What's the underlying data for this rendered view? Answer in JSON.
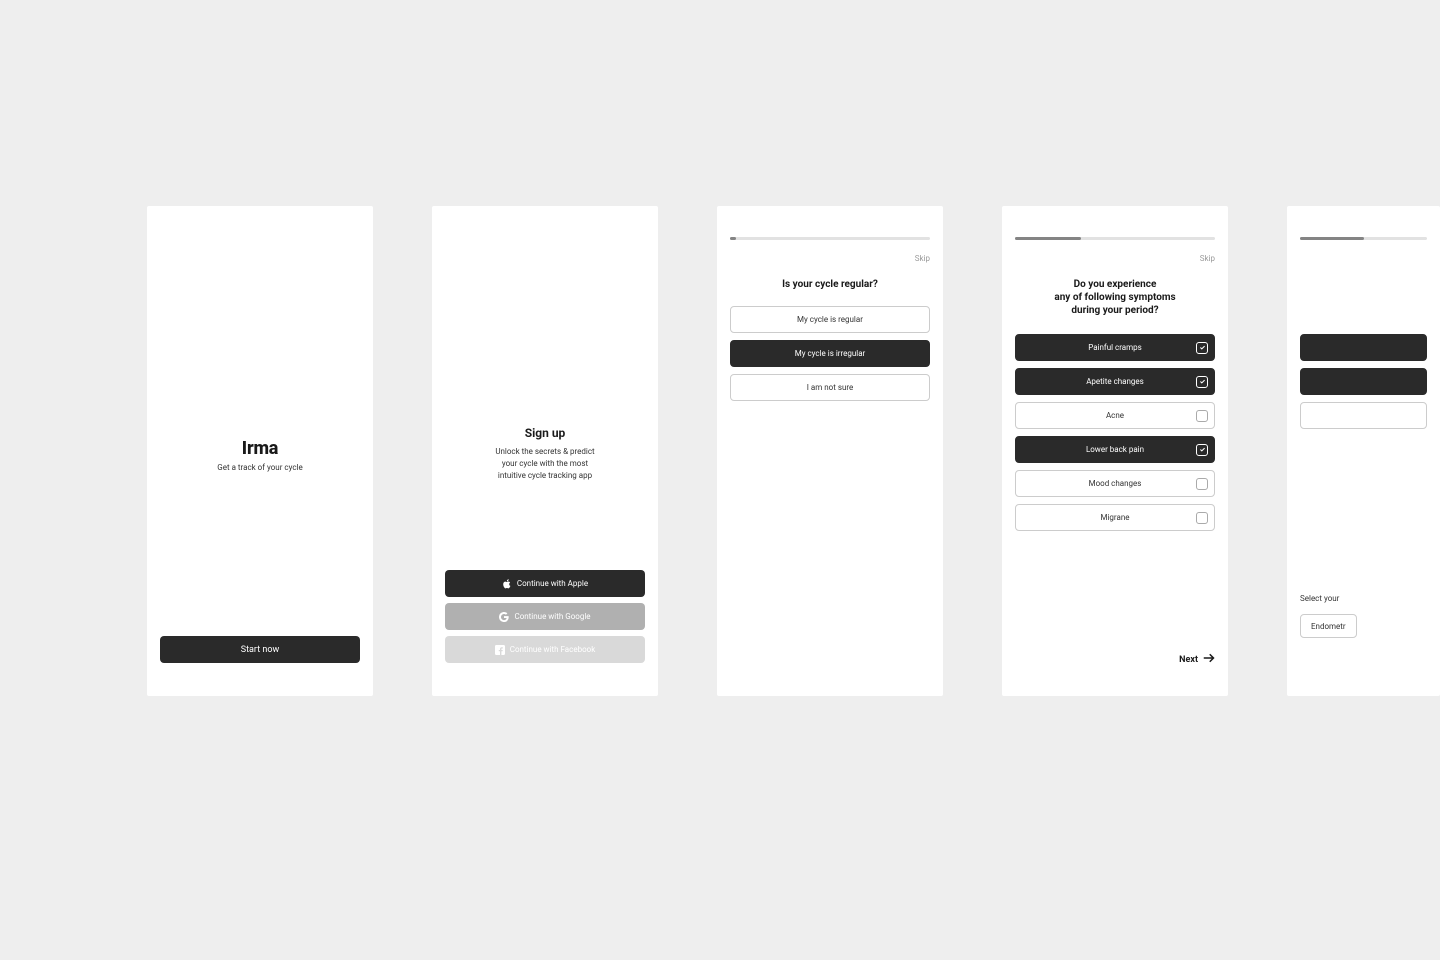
{
  "screen1": {
    "title": "Irma",
    "subtitle": "Get a track of your cycle",
    "start_button": "Start now"
  },
  "screen2": {
    "title": "Sign up",
    "description_line1": "Unlock the secrets & predict",
    "description_line2": "your cycle with the most",
    "description_line3": "intuitive cycle tracking app",
    "apple": "Continue with Apple",
    "google": "Continue with Google",
    "facebook": "Continue with Facebook"
  },
  "screen3": {
    "skip": "Skip",
    "question": "Is your cycle regular?",
    "options": [
      {
        "label": "My cycle is regular",
        "selected": false
      },
      {
        "label": "My cycle is irregular",
        "selected": true
      },
      {
        "label": "I am not sure",
        "selected": false
      }
    ],
    "progress_percent": 3
  },
  "screen4": {
    "skip": "Skip",
    "question_line1": "Do you experience",
    "question_line2": "any of following symptoms",
    "question_line3": "during your period?",
    "options": [
      {
        "label": "Painful cramps",
        "selected": true
      },
      {
        "label": "Apetite changes",
        "selected": true
      },
      {
        "label": "Acne",
        "selected": false
      },
      {
        "label": "Lower back pain",
        "selected": true
      },
      {
        "label": "Mood changes",
        "selected": false
      },
      {
        "label": "Migrane",
        "selected": false
      }
    ],
    "next": "Next",
    "progress_percent": 33
  },
  "screen5": {
    "label": "Select your",
    "chip": "Endometr",
    "progress_percent": 50
  }
}
